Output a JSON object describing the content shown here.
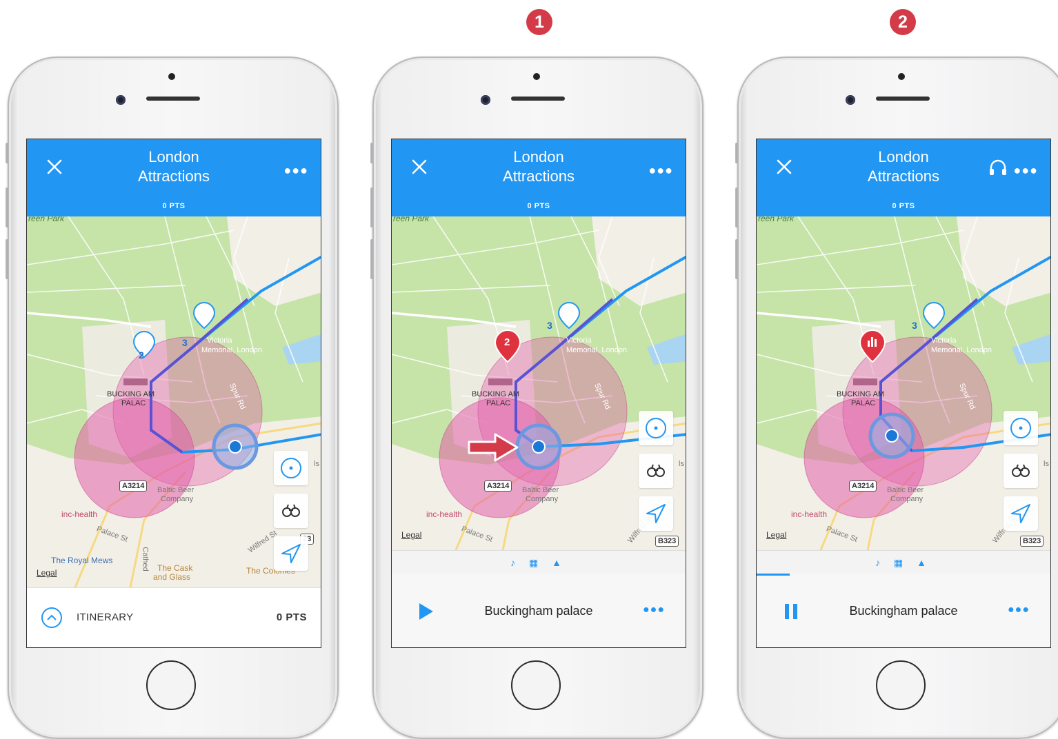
{
  "step_badges": [
    "1",
    "2"
  ],
  "header": {
    "title_line1": "London",
    "title_line2": "Attractions",
    "points": "0 PTS"
  },
  "map": {
    "park_label": "reen Park",
    "victoria_label_1": "Victoria",
    "victoria_label_2": "Memorial, London",
    "palace_label_1": "BUCKING AM",
    "palace_label_2": "PALAC",
    "spur_rd": "Spur Rd",
    "road_a3214": "A3214",
    "road_b323": "B323",
    "road_b323_partial": "23",
    "baltic_1": "Baltic Beer",
    "baltic_2": "Company",
    "inc_health": "inc-health",
    "palace_st": "Palace St",
    "wilfred_st": "Wilfred St",
    "royal_mews": "The Royal Mews",
    "cask_1": "The Cask",
    "cask_2": "and Glass",
    "colonies": "The Colonies",
    "cathedral": "Cathed",
    "ls_m": "ls M",
    "legal": "Legal",
    "marker_2": "2",
    "marker_3": "3"
  },
  "itinerary": {
    "label": "ITINERARY",
    "points": "0 PTS"
  },
  "player": {
    "title": "Buckingham palace",
    "media_icons": "♪ ▦ ▲"
  },
  "colors": {
    "accent": "#2196f3",
    "badge": "#d33b48",
    "park": "#c6e3a8",
    "zone_fill": "#e35aa9",
    "route": "#5a52d4"
  }
}
